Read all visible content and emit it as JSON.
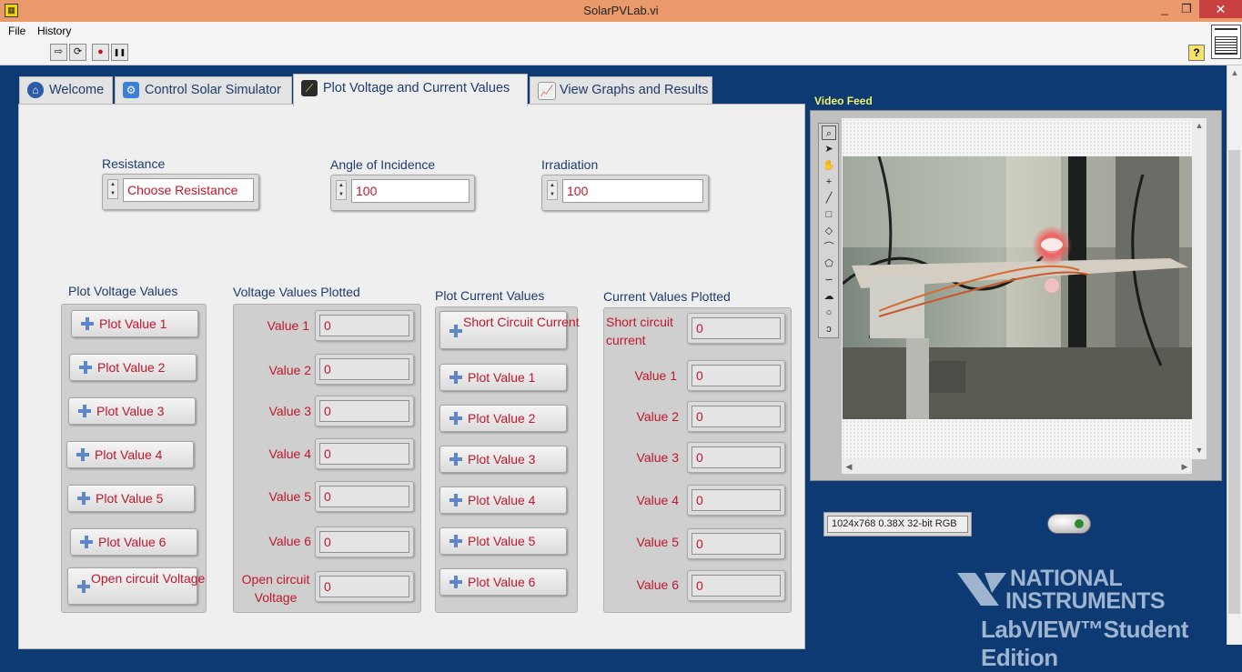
{
  "window": {
    "title": "SolarPVLab.vi",
    "minimize": "_",
    "maximize": "❐",
    "close": "✕",
    "app_icon": "labview-vi-icon"
  },
  "menu": [
    "File",
    "History"
  ],
  "toolbar": {
    "run": "⇨",
    "run_continuous": "⟳",
    "abort": "●",
    "pause": "❚❚",
    "help": "?"
  },
  "tabs": [
    {
      "label": "Welcome",
      "icon": "home-icon"
    },
    {
      "label": "Control Solar Simulator",
      "icon": "gear-icon"
    },
    {
      "label": "Plot Voltage and Current Values",
      "icon": "chart-icon"
    },
    {
      "label": "View Graphs and Results",
      "icon": "graph-icon"
    }
  ],
  "active_tab": 2,
  "controls": {
    "resistance": {
      "label": "Resistance",
      "value": "Choose Resistance"
    },
    "angle": {
      "label": "Angle of Incidence",
      "value": "100"
    },
    "irradiation": {
      "label": "Irradiation",
      "value": "100"
    }
  },
  "plot_voltage": {
    "title": "Plot Voltage Values",
    "buttons": [
      "Plot Value 1",
      "Plot Value 2",
      "Plot Value 3",
      "Plot Value 4",
      "Plot Value 5",
      "Plot Value 6",
      "Open circuit Voltage"
    ]
  },
  "voltage_plotted": {
    "title": "Voltage Values Plotted",
    "rows": [
      {
        "label": "Value 1",
        "value": "0"
      },
      {
        "label": "Value 2",
        "value": "0"
      },
      {
        "label": "Value 3",
        "value": "0"
      },
      {
        "label": "Value 4",
        "value": "0"
      },
      {
        "label": "Value 5",
        "value": "0"
      },
      {
        "label": "Value 6",
        "value": "0"
      },
      {
        "label": "Open circuit Voltage",
        "value": "0"
      }
    ]
  },
  "plot_current": {
    "title": "Plot Current Values",
    "buttons": [
      "Short Circuit Current",
      "Plot Value 1",
      "Plot Value 2",
      "Plot Value 3",
      "Plot Value 4",
      "Plot Value 5",
      "Plot Value 6"
    ]
  },
  "current_plotted": {
    "title": "Current Values Plotted",
    "rows": [
      {
        "label": "Short circuit current",
        "value": "0"
      },
      {
        "label": "Value 1",
        "value": "0"
      },
      {
        "label": "Value 2",
        "value": "0"
      },
      {
        "label": "Value 3",
        "value": "0"
      },
      {
        "label": "Value 4",
        "value": "0"
      },
      {
        "label": "Value 5",
        "value": "0"
      },
      {
        "label": "Value 6",
        "value": "0"
      }
    ]
  },
  "video": {
    "label": "Video Feed",
    "status": "1024x768 0.38X 32-bit RGB"
  },
  "logo": {
    "line1": "NATIONAL",
    "line2": "INSTRUMENTS",
    "line3": "LabVIEW™Student Edition"
  },
  "colors": {
    "panel_bg": "#0d3a73",
    "label_blue": "#1f3b70",
    "value_red": "#c0172b",
    "title_bar": "#e9996a"
  }
}
